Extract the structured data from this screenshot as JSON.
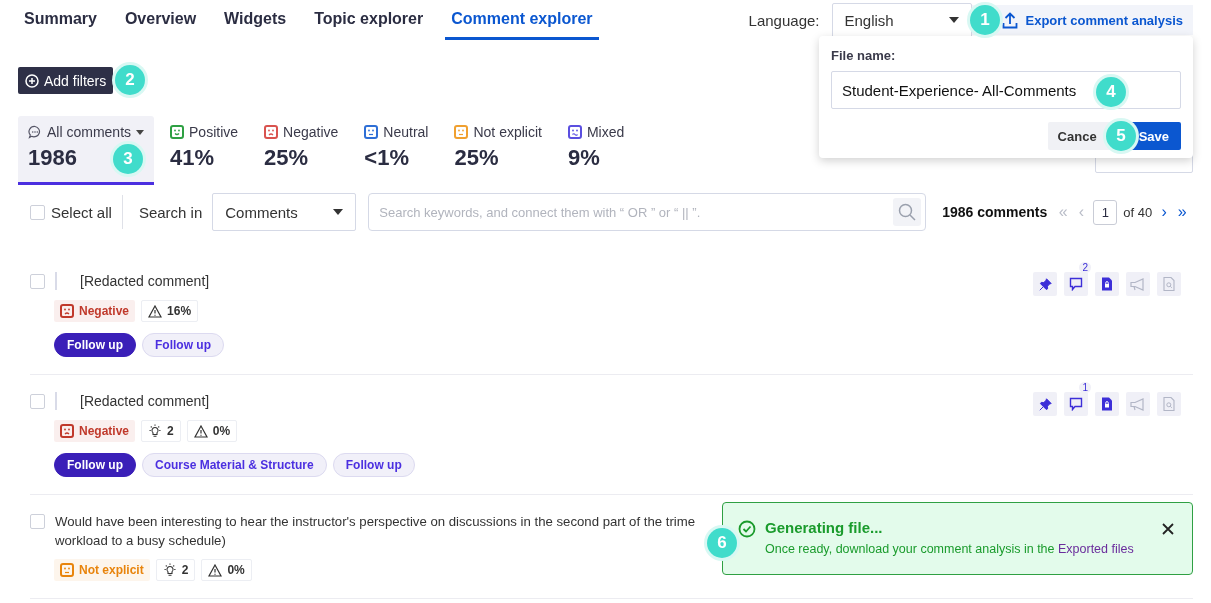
{
  "tabs": [
    {
      "label": "Summary",
      "selected": false
    },
    {
      "label": "Overview",
      "selected": false
    },
    {
      "label": "Widgets",
      "selected": false
    },
    {
      "label": "Topic explorer",
      "selected": false
    },
    {
      "label": "Comment explorer",
      "selected": true
    }
  ],
  "language": {
    "label": "Language:",
    "value": "English"
  },
  "export_button": {
    "label": "Export comment analysis"
  },
  "add_filters": {
    "label": "Add filters"
  },
  "sentiment_stats": [
    {
      "kind": "all",
      "label": "All comments",
      "value": "1986",
      "selected": true,
      "color": "#555566"
    },
    {
      "kind": "positive",
      "label": "Positive",
      "value": "41%",
      "selected": false,
      "color": "#2ea043"
    },
    {
      "kind": "negative",
      "label": "Negative",
      "value": "25%",
      "selected": false,
      "color": "#d9534f"
    },
    {
      "kind": "neutral",
      "label": "Neutral",
      "value": "<1%",
      "selected": false,
      "color": "#2f6fd6"
    },
    {
      "kind": "not_explicit",
      "label": "Not explicit",
      "value": "25%",
      "selected": false,
      "color": "#f0a030"
    },
    {
      "kind": "mixed",
      "label": "Mixed",
      "value": "9%",
      "selected": false,
      "color": "#5b4fe0"
    }
  ],
  "sort": {
    "kind": "dropdown"
  },
  "toolbar": {
    "select_all": {
      "label": "Select all",
      "checked": false
    },
    "search_in_label": "Search in",
    "search_in_value": "Comments",
    "search_placeholder": "Search keywords, and connect them with “ OR ” or “ || ”.",
    "count": "1986 comments",
    "page": "1",
    "page_total": "of 40",
    "pager": [
      {
        "symbol": "«",
        "disabled": true
      },
      {
        "symbol": "‹",
        "disabled": true
      },
      {
        "symbol": "›",
        "disabled": false
      },
      {
        "symbol": "»",
        "disabled": false
      }
    ]
  },
  "comments": [
    {
      "checked": false,
      "quoted": true,
      "lines": [
        "[Redacted comment]"
      ],
      "tags": [
        {
          "kind": "negative",
          "label": "Negative",
          "color": "#c0392b"
        },
        {
          "kind": "risk",
          "label": "16%"
        }
      ],
      "chips": [
        {
          "label": "Follow up",
          "selected": true
        },
        {
          "label": "Follow up",
          "selected": false
        }
      ],
      "actions": [
        {
          "kind": "pin",
          "active": true
        },
        {
          "kind": "comment",
          "active": true,
          "count": "2"
        },
        {
          "kind": "document",
          "active": true
        },
        {
          "kind": "megaphone",
          "active": false
        },
        {
          "kind": "search_document",
          "active": false
        }
      ]
    },
    {
      "checked": false,
      "quoted": true,
      "lines": [
        "[Redacted comment]"
      ],
      "tags": [
        {
          "kind": "negative",
          "label": "Negative",
          "color": "#c0392b"
        },
        {
          "kind": "ideas",
          "label": "2"
        },
        {
          "kind": "risk",
          "label": "0%"
        }
      ],
      "chips": [
        {
          "label": "Follow up",
          "selected": true
        },
        {
          "label": "Course Material & Structure",
          "selected": false
        },
        {
          "label": "Follow up",
          "selected": false
        }
      ],
      "actions": [
        {
          "kind": "pin",
          "active": true
        },
        {
          "kind": "comment",
          "active": true,
          "count": "1"
        },
        {
          "kind": "document",
          "active": true
        },
        {
          "kind": "megaphone",
          "active": false
        },
        {
          "kind": "search_document",
          "active": false
        }
      ]
    },
    {
      "checked": false,
      "quoted": false,
      "lines": [
        "Would have been interesting to hear the instructor's perspective on discussions in the second part of the trime",
        "workload to a busy schedule)"
      ],
      "tags": [
        {
          "kind": "not_explicit",
          "label": "Not explicit",
          "color": "#e8840c"
        },
        {
          "kind": "ideas",
          "label": "2"
        },
        {
          "kind": "risk",
          "label": "0%"
        }
      ]
    }
  ],
  "export_popover": {
    "label": "File name:",
    "value": "Student-Experience- All-Comments",
    "buttons": [
      {
        "kind": "secondary",
        "label": "Cance"
      },
      {
        "kind": "primary",
        "label": "Save"
      }
    ]
  },
  "toast": {
    "title": "Generating file...",
    "message": "Once ready, download your comment analysis in the ",
    "link": "Exported files"
  },
  "steps": [
    "1",
    "2",
    "3",
    "4",
    "5",
    "6"
  ]
}
